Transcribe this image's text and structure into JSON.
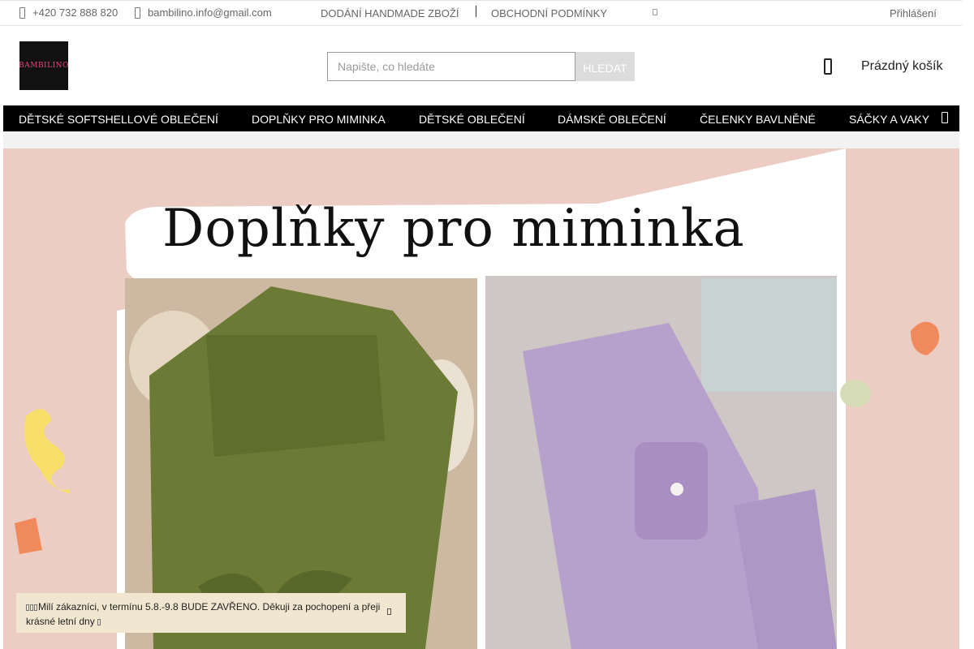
{
  "topbar": {
    "phone": "+420 732 888 820",
    "email": "bambilino.info@gmail.com",
    "links": [
      "DODÁNÍ HANDMADE ZBOŽÍ",
      "OBCHODNÍ PODMÍNKY"
    ],
    "login": "Přihlášení",
    "icons": [
      "phone-icon",
      "mail-icon",
      "chevron-down-icon"
    ]
  },
  "header": {
    "logo_text": "BAMBILINO",
    "search": {
      "placeholder": "Napište, co hledáte",
      "button": "HLEDAT"
    },
    "cart": {
      "label": "Prázdný košík",
      "icon": "cart-icon"
    }
  },
  "nav": {
    "items": [
      "DĚTSKÉ SOFTSHELLOVÉ OBLEČENÍ",
      "DOPLŇKY PRO MIMINKA",
      "DĚTSKÉ OBLEČENÍ",
      "DÁMSKÉ OBLEČENÍ",
      "ČELENKY BAVLNĚNÉ",
      "SÁČKY A VAKY"
    ],
    "more_icon": "chevron-right-icon"
  },
  "banner": {
    "title": "Doplňky pro miminka",
    "colors": {
      "background": "#eccdc4",
      "swaddle": "#6b7a34",
      "folder": "#b6a0cc",
      "accent_orange": "#f08a5d",
      "accent_yellow": "#f7df6a",
      "accent_green": "#d5dcb6"
    }
  },
  "notice": {
    "text": "Milí zákazníci, v termínu 5.8.-9.8 BUDE ZAVŘENO. Děkuji za pochopení a přeji krásné letní dny"
  }
}
